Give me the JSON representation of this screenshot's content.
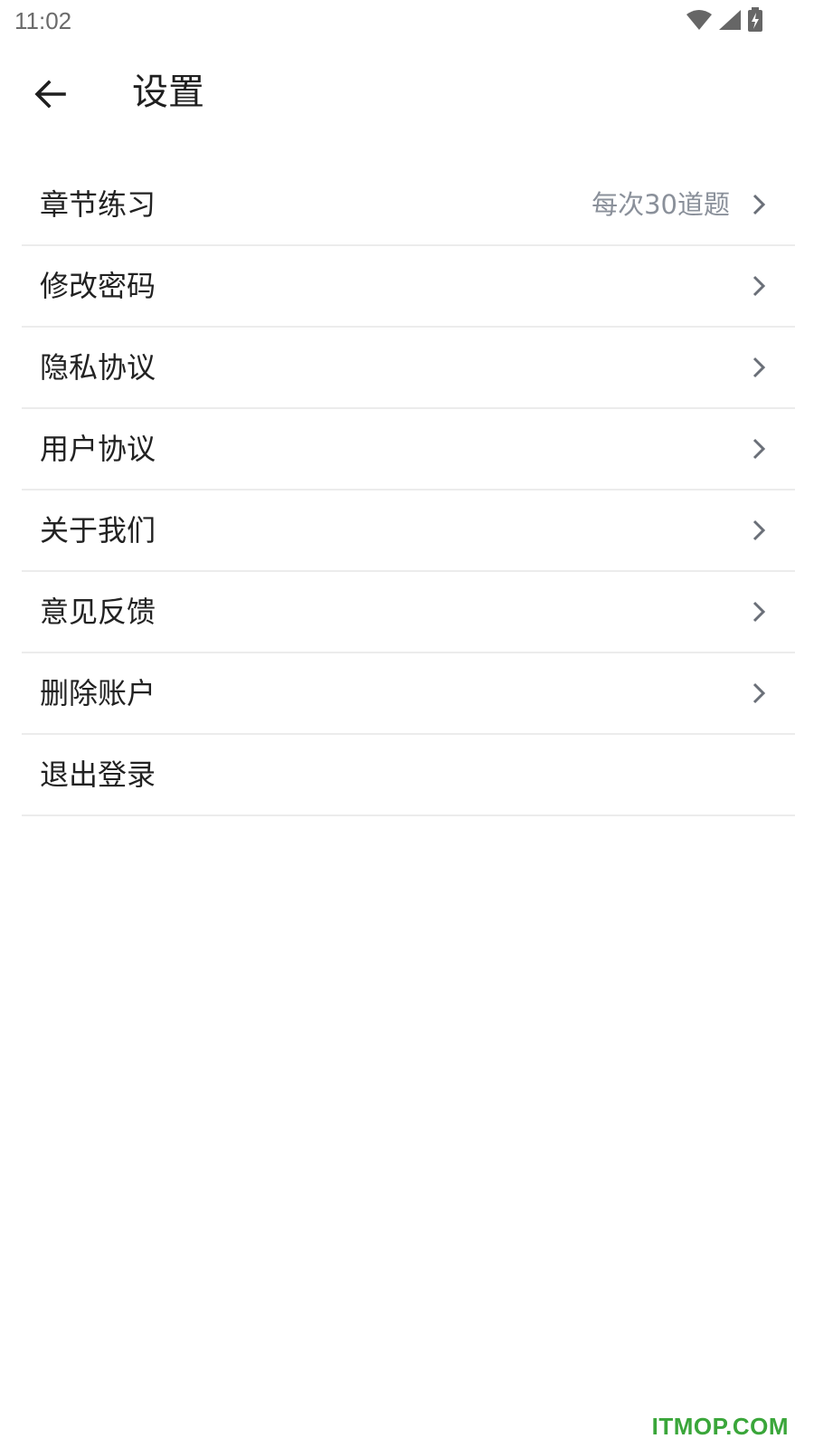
{
  "status_bar": {
    "time": "11:02",
    "icons": [
      "wifi-icon",
      "signal-icon",
      "battery-charging-icon"
    ],
    "icon_color": "#666666"
  },
  "toolbar": {
    "back_icon": "arrow-left-icon",
    "title": "设置"
  },
  "settings": {
    "items": [
      {
        "label": "章节练习",
        "value": "每次30道题",
        "chevron": true
      },
      {
        "label": "修改密码",
        "value": "",
        "chevron": true
      },
      {
        "label": "隐私协议",
        "value": "",
        "chevron": true
      },
      {
        "label": "用户协议",
        "value": "",
        "chevron": true
      },
      {
        "label": "关于我们",
        "value": "",
        "chevron": true
      },
      {
        "label": "意见反馈",
        "value": "",
        "chevron": true
      },
      {
        "label": "删除账户",
        "value": "",
        "chevron": true
      },
      {
        "label": "退出登录",
        "value": "",
        "chevron": false
      }
    ],
    "chevron_color": "#6a6f78",
    "divider_color": "#ececec"
  },
  "watermark": {
    "text": "ITMOP.COM",
    "color": "#3aa63a"
  }
}
